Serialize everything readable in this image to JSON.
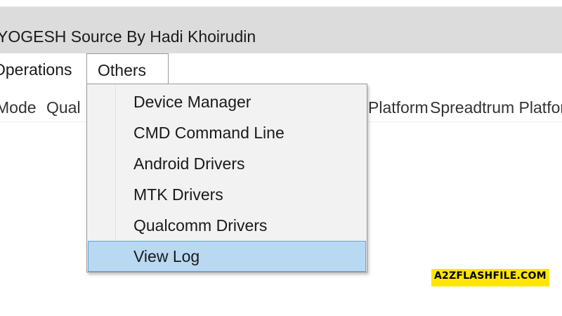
{
  "window": {
    "title": "YOGESH Source By Hadi Khoirudin"
  },
  "menubar": {
    "items": [
      {
        "label": "Operations"
      },
      {
        "label": "Others"
      }
    ]
  },
  "tabs": [
    {
      "label": "Mode"
    },
    {
      "label": "Qual"
    },
    {
      "label": "Platform"
    },
    {
      "label": "Spreadtrum Platform"
    }
  ],
  "others_menu": {
    "items": [
      {
        "label": "Device Manager"
      },
      {
        "label": "CMD Command Line"
      },
      {
        "label": "Android Drivers"
      },
      {
        "label": "MTK Drivers"
      },
      {
        "label": "Qualcomm Drivers"
      },
      {
        "label": "View Log",
        "selected": true
      }
    ]
  },
  "watermark": {
    "text": "A2ZFLASHFILE.COM"
  },
  "colors": {
    "titlebar": "#dcdcdc",
    "menu_background": "#f2f2f2",
    "highlight": "#b9d8f2",
    "highlight_border": "#66a3d8",
    "watermark_bg": "#ffe600"
  }
}
